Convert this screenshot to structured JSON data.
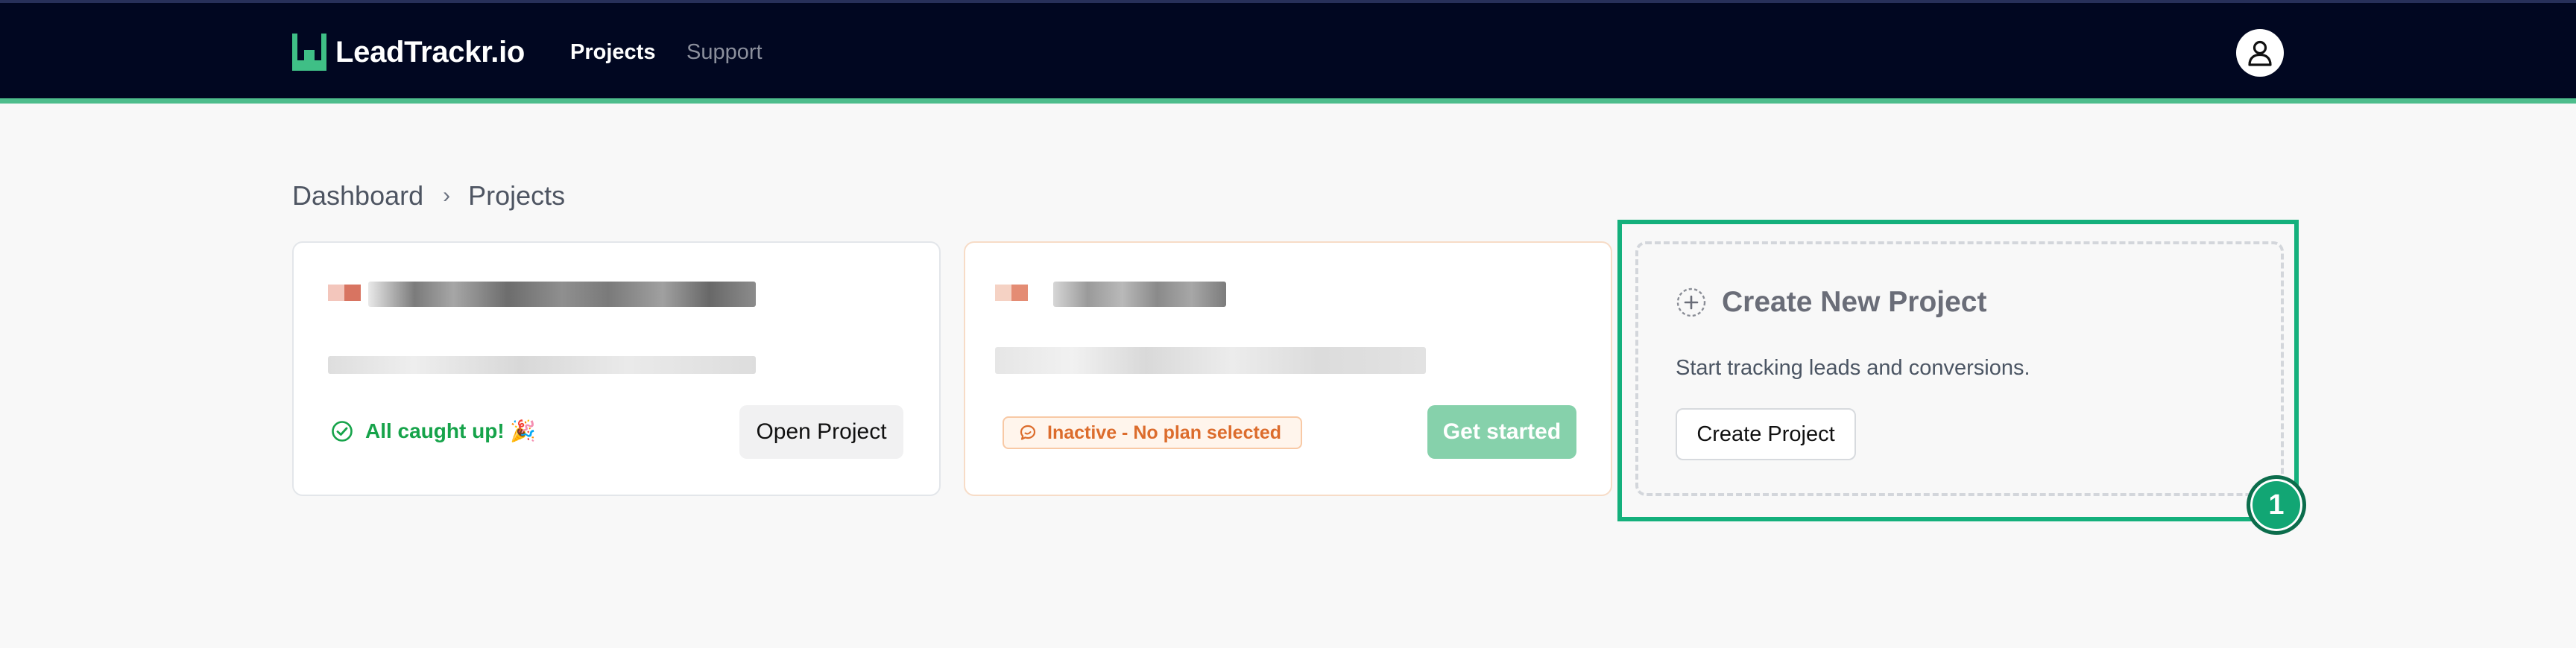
{
  "app": {
    "name": "LeadTrackr.io",
    "logo_icon": "leadtrackr-logo-icon",
    "colors": {
      "nav_bg": "#010721",
      "accent": "#4ebd8c",
      "success": "#16a34a",
      "warning": "#dc6c2c",
      "highlight": "#14b07c"
    }
  },
  "nav": {
    "links": [
      {
        "label": "Projects",
        "active": true
      },
      {
        "label": "Support",
        "active": false
      }
    ],
    "user_icon": "user-avatar-icon"
  },
  "breadcrumb": {
    "items": [
      "Dashboard",
      "Projects"
    ],
    "separator": "›"
  },
  "projects": [
    {
      "name_redacted": true,
      "status_icon": "check-circle-icon",
      "status": "All caught up! 🎉",
      "action_label": "Open Project"
    },
    {
      "name_redacted": true,
      "status_icon": "chat-bubble-icon",
      "status": "Inactive - No plan selected",
      "action_label": "Get started"
    }
  ],
  "create_card": {
    "icon": "dashed-plus-circle-icon",
    "title": "Create New Project",
    "description": "Start tracking leads and conversions.",
    "button_label": "Create Project"
  },
  "annotation": {
    "label": "1"
  }
}
